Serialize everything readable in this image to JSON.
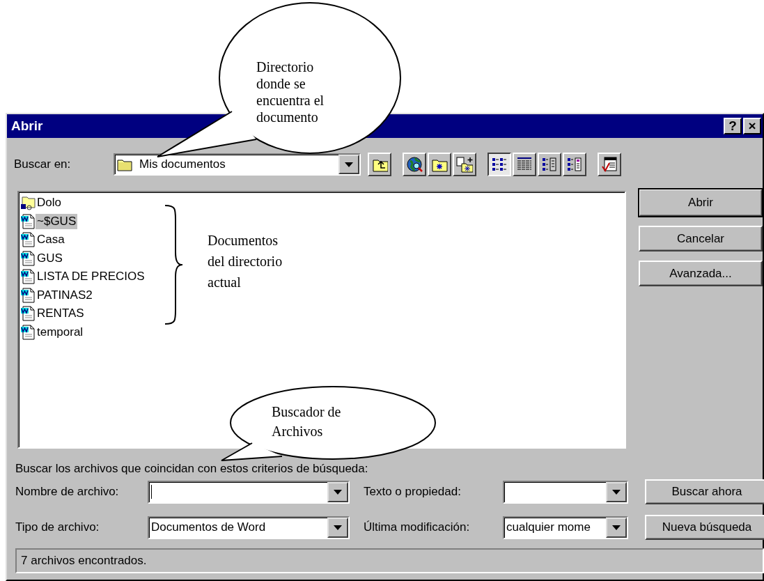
{
  "window": {
    "title": "Abrir",
    "help_button": "?",
    "close_button": "×"
  },
  "look_in": {
    "label": "Buscar en:",
    "value": "Mis documentos"
  },
  "toolbar": {
    "view_buttons": [
      {
        "selected": true
      },
      {
        "selected": false
      },
      {
        "selected": false
      },
      {
        "selected": false
      }
    ]
  },
  "files": [
    {
      "name": "Dolo",
      "kind": "folder",
      "selected": false
    },
    {
      "name": "~$GUS",
      "kind": "document",
      "selected": true
    },
    {
      "name": "Casa",
      "kind": "document",
      "selected": false
    },
    {
      "name": "GUS",
      "kind": "document",
      "selected": false
    },
    {
      "name": "LISTA DE PRECIOS",
      "kind": "document",
      "selected": false
    },
    {
      "name": "PATINAS2",
      "kind": "document",
      "selected": false
    },
    {
      "name": "RENTAS",
      "kind": "document",
      "selected": false
    },
    {
      "name": "temporal",
      "kind": "document",
      "selected": false
    }
  ],
  "buttons": [
    {
      "label": "Abrir",
      "default": true
    },
    {
      "label": "Cancelar",
      "default": false
    },
    {
      "label": "Avanzada...",
      "default": false
    }
  ],
  "criteria": {
    "heading": "Buscar los archivos que coincidan con estos criterios de búsqueda:",
    "file_name": {
      "label": "Nombre de archivo:",
      "focused": true
    },
    "text_or_property": {
      "label": "Texto o propiedad:",
      "focused": false
    },
    "file_type": {
      "label": "Tipo de archivo:",
      "value": "Documentos de Word",
      "focused": false
    },
    "last_modified": {
      "label": "Última modificación:",
      "value": "cualquier mome",
      "focused": false
    },
    "search_buttons": [
      "Buscar ahora",
      "Nueva búsqueda"
    ]
  },
  "status_bar": "7 archivos encontrados.",
  "annotations": [
    {
      "kind": "bubble",
      "lines": [
        "Directorio",
        "donde se",
        "encuentra el",
        "documento"
      ]
    },
    {
      "kind": "brace",
      "lines": [
        "Documentos",
        "del directorio",
        "actual"
      ]
    },
    {
      "kind": "bubble",
      "lines": [
        "Buscador de",
        "Archivos"
      ]
    }
  ]
}
